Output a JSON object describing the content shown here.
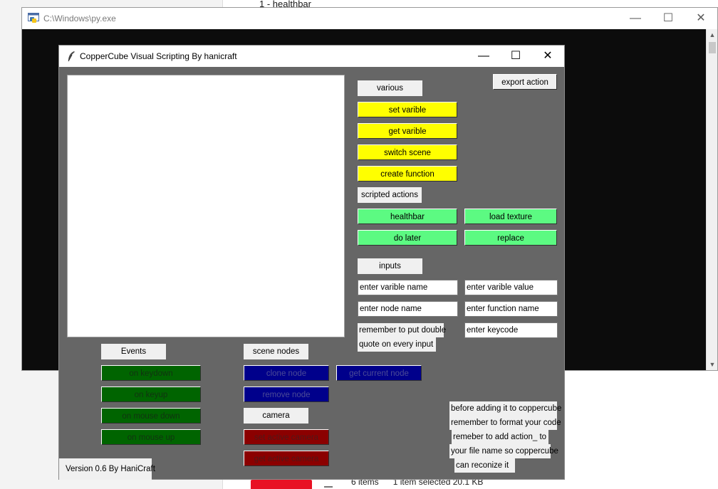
{
  "background": {
    "explorer_item": "1 - healthbar",
    "status": {
      "items": "6 items",
      "selected": "1 item selected  20.1 KB"
    }
  },
  "console": {
    "title": "C:\\Windows\\py.exe",
    "minimize": "—",
    "maximize": "☐",
    "close": "✕"
  },
  "app": {
    "title": "CopperCube Visual Scripting By hanicraft",
    "minimize": "—",
    "maximize": "☐",
    "close": "✕",
    "export_action": "export action",
    "various_label": "various",
    "various_buttons": [
      "set varible",
      "get varible",
      "switch scene",
      "create function"
    ],
    "scripted_label": "scripted actions",
    "scripted_buttons": [
      "healthbar",
      "load texture",
      "do later",
      "replace"
    ],
    "inputs_label": "inputs",
    "inputs": {
      "varible_name": "enter varible name",
      "varible_value": "enter varible value",
      "node_name": "enter node name",
      "function_name": "enter function name",
      "keycode": "enter keycode"
    },
    "quote_note": [
      "remember to put double",
      "quote on every input"
    ],
    "events_label": "Events",
    "events_buttons": [
      "on keydown",
      "on keyup",
      "on mouse down",
      "on mouse up"
    ],
    "scene_nodes_label": "scene nodes",
    "scene_nodes_buttons": [
      "clone node",
      "get current node",
      "remove node"
    ],
    "camera_label": "camera",
    "camera_buttons": [
      "set active camera",
      "get active camera"
    ],
    "notice": [
      "before adding it to coppercube",
      "remember to format your code",
      "remeber to add action_ to",
      "your file name so coppercube",
      "can reconize it"
    ],
    "version": "Version 0.6 By HaniCraft"
  },
  "colors": {
    "app_bg": "#666666",
    "yellow": "#ffff00",
    "light_green": "#5cfa82",
    "dark_green": "#006400",
    "dark_blue": "#00008b",
    "dark_red": "#8b0000",
    "console_bg": "#0c0c0c"
  },
  "icons": [
    "python-console-icon",
    "feather-icon",
    "minimize-icon",
    "maximize-icon",
    "close-icon",
    "scroll-up-icon",
    "scroll-down-icon"
  ]
}
